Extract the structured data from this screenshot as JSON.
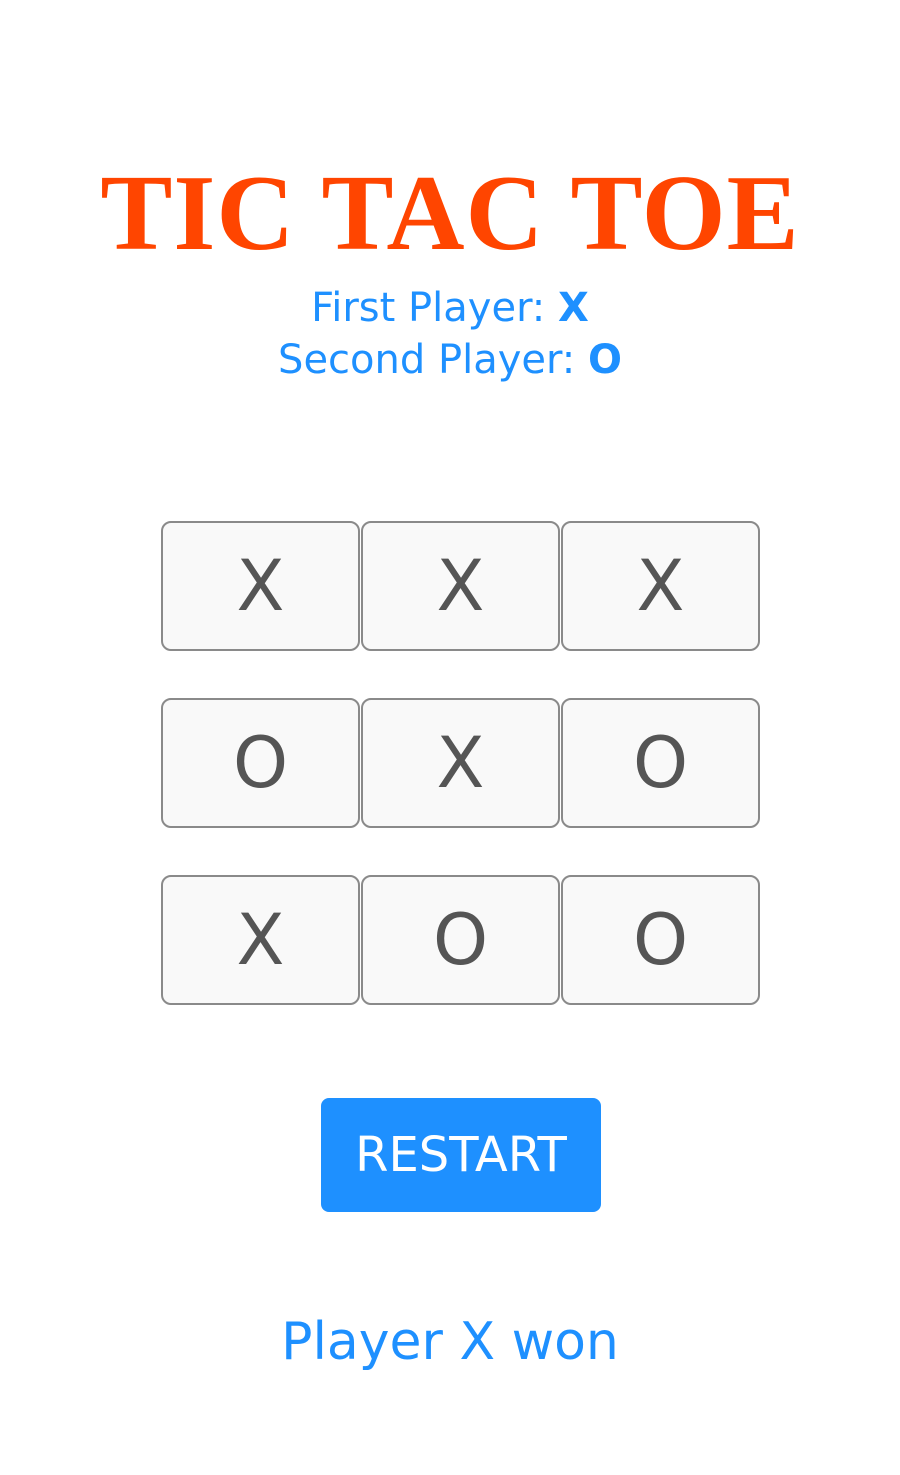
{
  "title": "TIC TAC TOE",
  "players": {
    "first_label": "First Player: ",
    "first_mark": "X",
    "second_label": "Second Player: ",
    "second_mark": "O"
  },
  "board": {
    "rows": [
      [
        "X",
        "X",
        "X"
      ],
      [
        "O",
        "X",
        "O"
      ],
      [
        "X",
        "O",
        "O"
      ]
    ]
  },
  "restart_label": "RESTART",
  "status": "Player X won",
  "colors": {
    "title": "#ff4500",
    "accent": "#1e90ff",
    "cell_text": "#555555",
    "cell_bg": "#f9f9f9",
    "cell_border": "#8a8a8a"
  }
}
